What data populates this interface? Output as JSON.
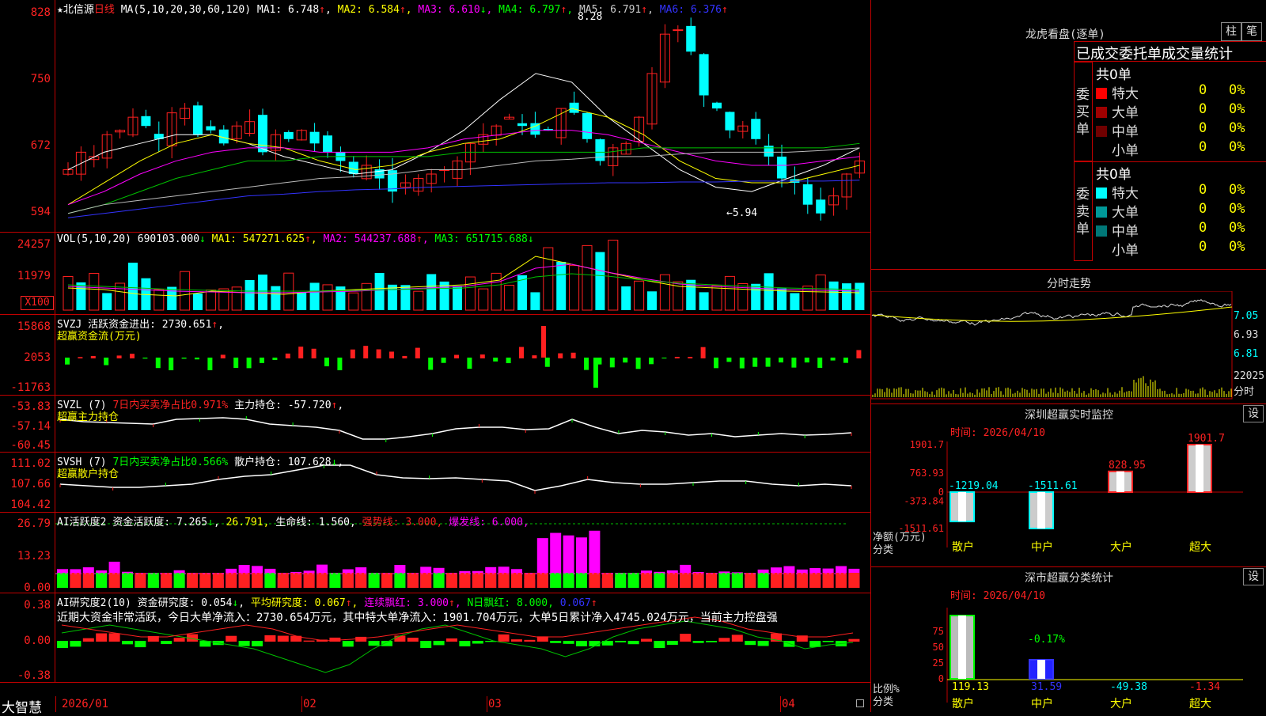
{
  "main": {
    "stock_star": "★",
    "stock_name": "北信源",
    "period": "日线",
    "ma_label": "MA(5,10,20,30,60,120)",
    "ma": [
      {
        "label": "MA1:",
        "value": "6.748",
        "arrow": "↑",
        "color": "#ffffff"
      },
      {
        "label": "MA2:",
        "value": "6.584",
        "arrow": "↑",
        "color": "#ffff00"
      },
      {
        "label": "MA3:",
        "value": "6.610",
        "arrow": "↓",
        "color": "#ff00ff"
      },
      {
        "label": "MA4:",
        "value": "6.797",
        "arrow": "↑",
        "color": "#00ff00"
      },
      {
        "label": "MA5:",
        "value": "6.791",
        "arrow": "↑",
        "color": "#cccccc"
      },
      {
        "label": "MA6:",
        "value": "6.376",
        "arrow": "↑",
        "color": "#3333ff"
      }
    ],
    "y_labels": [
      "828",
      "750",
      "672",
      "594"
    ],
    "high_label": "8.28",
    "low_label": "←5.94",
    "high_value": 8.28,
    "low_value": 5.94
  },
  "vol": {
    "label": "VOL(5,10,20)",
    "value": "690103.000",
    "arrow": "↓",
    "ma": [
      {
        "label": "MA1:",
        "value": "547271.625",
        "arrow": "↑",
        "color": "#ffff00"
      },
      {
        "label": "MA2:",
        "value": "544237.688",
        "arrow": "↑",
        "color": "#ff00ff"
      },
      {
        "label": "MA3:",
        "value": "651715.688",
        "arrow": "↓",
        "color": "#00ff00"
      }
    ],
    "y_labels": [
      "24257",
      "11979"
    ],
    "unit_label": "X100"
  },
  "svzj": {
    "label": "SVZJ",
    "text": "活跃资金进出:",
    "value": "2730.651",
    "arrow": "↑",
    "tail": ",",
    "line2": "超赢资金流(万元)",
    "y_labels": [
      "15868",
      "2053",
      "-11763"
    ]
  },
  "svzl": {
    "label": "SVZL (7)",
    "text1": "7日内买卖净占比0.971%",
    "text2": "主力持仓:",
    "value": "-57.720",
    "arrow": "↑",
    "tail": ",",
    "line2": "超赢主力持仓",
    "y_labels": [
      "-53.83",
      "-57.14",
      "-60.45"
    ]
  },
  "svsh": {
    "label": "SVSH (7)",
    "text1": "7日内买卖净占比0.566%",
    "text2": "散户持仓:",
    "value": "107.628",
    "arrow": "↓",
    "tail": ",",
    "line2": "超赢散户持仓",
    "y_labels": [
      "111.02",
      "107.66",
      "104.42"
    ]
  },
  "ai1": {
    "label": "AI活跃度2",
    "text": "资金活跃度:",
    "value": "7.265",
    "arrow1": "↓",
    "v2": "26.791",
    "text2": "生命线:",
    "v3": "1.560",
    "text3": "强势线:",
    "v4": "3.000",
    "text4": "爆发线:",
    "v5": "6.000",
    "y_labels": [
      "26.79",
      "13.23",
      "0.00"
    ]
  },
  "ai2": {
    "label": "AI研究度2(10)",
    "text1": "资金研究度:",
    "v1": "0.054",
    "a1": "↓",
    "text2": "平均研究度:",
    "v2": "0.067",
    "a2": "↑",
    "text3": "连续飘红:",
    "v3": "3.000",
    "a3": "↑",
    "text4": "N日飘红:",
    "v4": "8.000",
    "v5": "0.067",
    "a5": "↑",
    "comment": "近期大资金非常活跃，今日大单净流入：2730.654万元，其中特大单净流入：1901.704万元，大单5日累计净入4745.024万元，当前主力控盘强",
    "y_labels": [
      "0.38",
      "0.00",
      "-0.38"
    ]
  },
  "footer": {
    "brand": "大智慧",
    "dates": [
      "2026/01",
      "02",
      "03",
      "04"
    ]
  },
  "dragon": {
    "title": "龙虎看盘(逐单)",
    "btn_bar": "柱",
    "btn_pen": "笔",
    "subtitle": "已成交委托单成交量统计",
    "buy": {
      "side_label": "委买单",
      "total": "共0单",
      "rows": [
        {
          "name": "特大",
          "count": "0",
          "pct": "0%",
          "color": "#ff0000"
        },
        {
          "name": "大单",
          "count": "0",
          "pct": "0%",
          "color": "#a00000"
        },
        {
          "name": "中单",
          "count": "0",
          "pct": "0%",
          "color": "#700000"
        },
        {
          "name": "小单",
          "count": "0",
          "pct": "0%",
          "color": "#000000"
        }
      ]
    },
    "sell": {
      "side_label": "委卖单",
      "total": "共0单",
      "rows": [
        {
          "name": "特大",
          "count": "0",
          "pct": "0%",
          "color": "#00ffff"
        },
        {
          "name": "大单",
          "count": "0",
          "pct": "0%",
          "color": "#009999"
        },
        {
          "name": "中单",
          "count": "0",
          "pct": "0%",
          "color": "#007777"
        },
        {
          "name": "小单",
          "count": "0",
          "pct": "0%",
          "color": "#000000"
        }
      ]
    }
  },
  "intraday": {
    "title": "分时走势",
    "y_labels": [
      "7.05",
      "6.93",
      "6.81"
    ],
    "vol_label": "22025",
    "tab": "分时"
  },
  "monitor": {
    "title": "深圳超赢实时监控",
    "settings": "设",
    "time": "时间: 2026/04/10",
    "y_labels": [
      "1901.7",
      "763.93",
      "0",
      "-373.84",
      "-1511.61"
    ],
    "axis_label": "净额(万元)",
    "axis_label2": "分类",
    "chart_data": {
      "type": "bar",
      "categories": [
        "散户",
        "中户",
        "大户",
        "超大"
      ],
      "values": [
        -1219.04,
        -1511.61,
        828.95,
        1901.7
      ],
      "value_labels": [
        "-1219.04",
        "-1511.61",
        "828.95",
        "1901.7"
      ],
      "ylim": [
        -1511.61,
        1901.7
      ]
    }
  },
  "classify": {
    "title": "深市超赢分类统计",
    "settings": "设",
    "time": "时间: 2026/04/10",
    "y_labels": [
      "75",
      "50",
      "25",
      "0"
    ],
    "axis_label": "比例%",
    "axis_label2": "分类",
    "chart_data": {
      "type": "bar",
      "categories": [
        "散户",
        "中户",
        "大户",
        "超大"
      ],
      "values": [
        119.13,
        31.59,
        -49.38,
        -1.34
      ],
      "bar_heights": [
        100,
        30,
        0,
        0
      ],
      "top_label": "-0.17%",
      "ylim": [
        0,
        100
      ]
    }
  }
}
